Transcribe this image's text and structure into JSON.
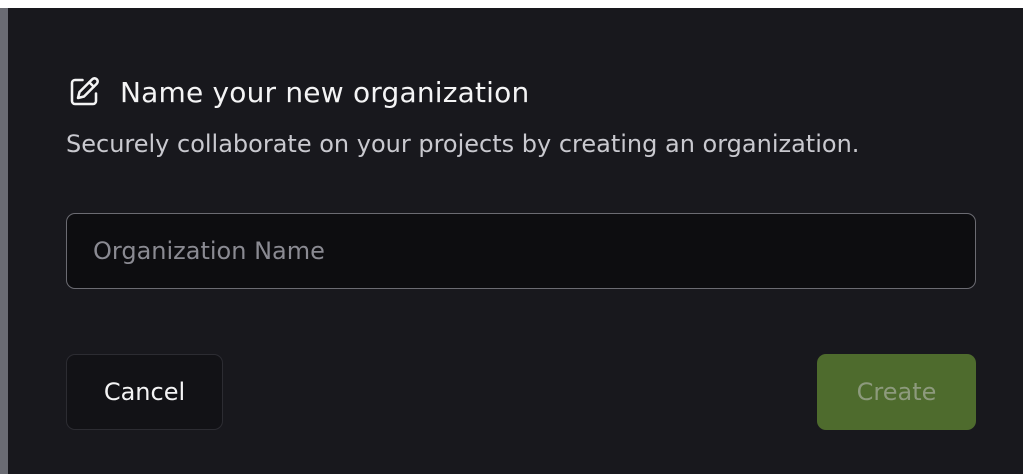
{
  "dialog": {
    "title": "Name your new organization",
    "title_icon": "edit-pencil-icon",
    "subtitle": "Securely collaborate on your projects by creating an organization.",
    "input": {
      "placeholder": "Organization Name",
      "value": ""
    },
    "cancel_label": "Cancel",
    "create_label": "Create",
    "create_disabled": true
  },
  "colors": {
    "dialog_background": "#18181d",
    "accent_disabled": "#4e6b2d",
    "backdrop": "#ffffff"
  }
}
